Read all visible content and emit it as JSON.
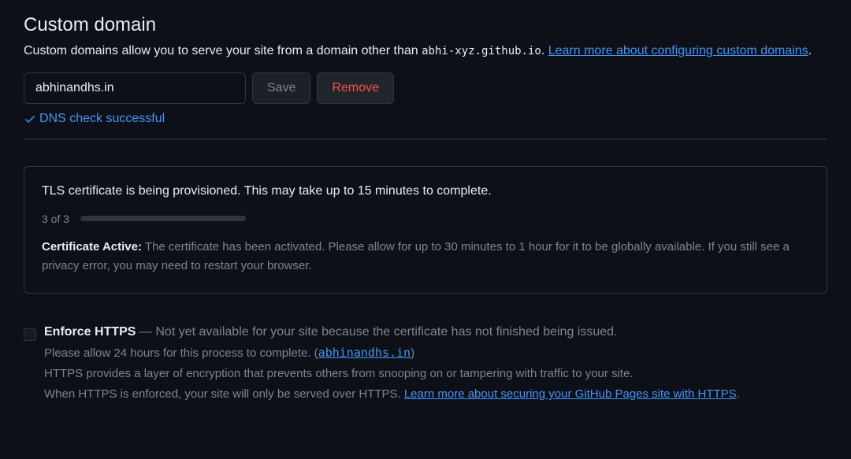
{
  "header": {
    "title": "Custom domain",
    "desc_prefix": "Custom domains allow you to serve your site from a domain other than ",
    "repo_code": "abhi-xyz.github.io",
    "desc_suffix_period": ". ",
    "learn_more": "Learn more about configuring custom domains",
    "trailing_period": "."
  },
  "domain": {
    "value": "abhinandhs.in",
    "save_label": "Save",
    "remove_label": "Remove",
    "dns_status": "DNS check successful"
  },
  "tls": {
    "message": "TLS certificate is being provisioned. This may take up to 15 minutes to complete.",
    "progress_label": "3 of 3",
    "cert_title": "Certificate Active:",
    "cert_desc": "The certificate has been activated. Please allow for up to 30 minutes to 1 hour for it to be globally available. If you still see a privacy error, you may need to restart your browser."
  },
  "https": {
    "title": "Enforce HTTPS",
    "dash": " — ",
    "not_available": "Not yet available for your site because the certificate has not finished being issued.",
    "line2_prefix": "Please allow 24 hours for this process to complete. (",
    "link_domain": "abhinandhs.in",
    "line2_suffix": ")",
    "line3": "HTTPS provides a layer of encryption that prevents others from snooping on or tampering with traffic to your site.",
    "line4_prefix": "When HTTPS is enforced, your site will only be served over HTTPS. ",
    "line4_link": "Learn more about securing your GitHub Pages site with HTTPS",
    "line4_suffix": "."
  }
}
